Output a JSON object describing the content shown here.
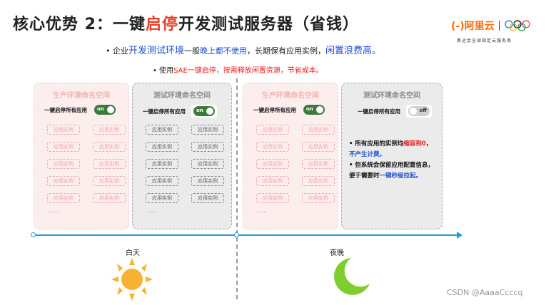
{
  "title": {
    "pre": "核心优势 2：一键",
    "red": "启停",
    "post": "开发测试服务器（省钱）"
  },
  "logo": {
    "brand": "(-)阿里云",
    "sub": "奥运会全球指定云服务商"
  },
  "bullet1": {
    "a": "企业",
    "b": "开发测试环境",
    "c": "一般",
    "d": "晚上都不使用",
    "e": "，长期保有应用实例，",
    "f": "闲置浪费高。"
  },
  "bullet2": {
    "a": "使用",
    "b": "SAE一键启停，按需释放闲置资源，节省成本。"
  },
  "panels": {
    "prod_title": "生产环境命名空间",
    "test_title": "测试环境命名空间",
    "toggle_label": "一键启停所有应用",
    "on": "on",
    "off": "off",
    "instance": "应用实例",
    "dots": "......"
  },
  "note": {
    "l1a": "所有应用的实例均",
    "l1b": "缩容到0",
    "l1c": "，",
    "l2": "不产生计费。",
    "l3": "但系统会保留应用配置信息，",
    "l4a": "便于需要时",
    "l4b": "一键秒级拉起。"
  },
  "timeline": {
    "day": "白天",
    "night": "夜晚"
  },
  "watermark": "CSDN @AaaaCcccq",
  "colors": {
    "accent_red": "#e8402c",
    "accent_blue": "#1f4fd6",
    "timeline": "#1e9ee0"
  }
}
